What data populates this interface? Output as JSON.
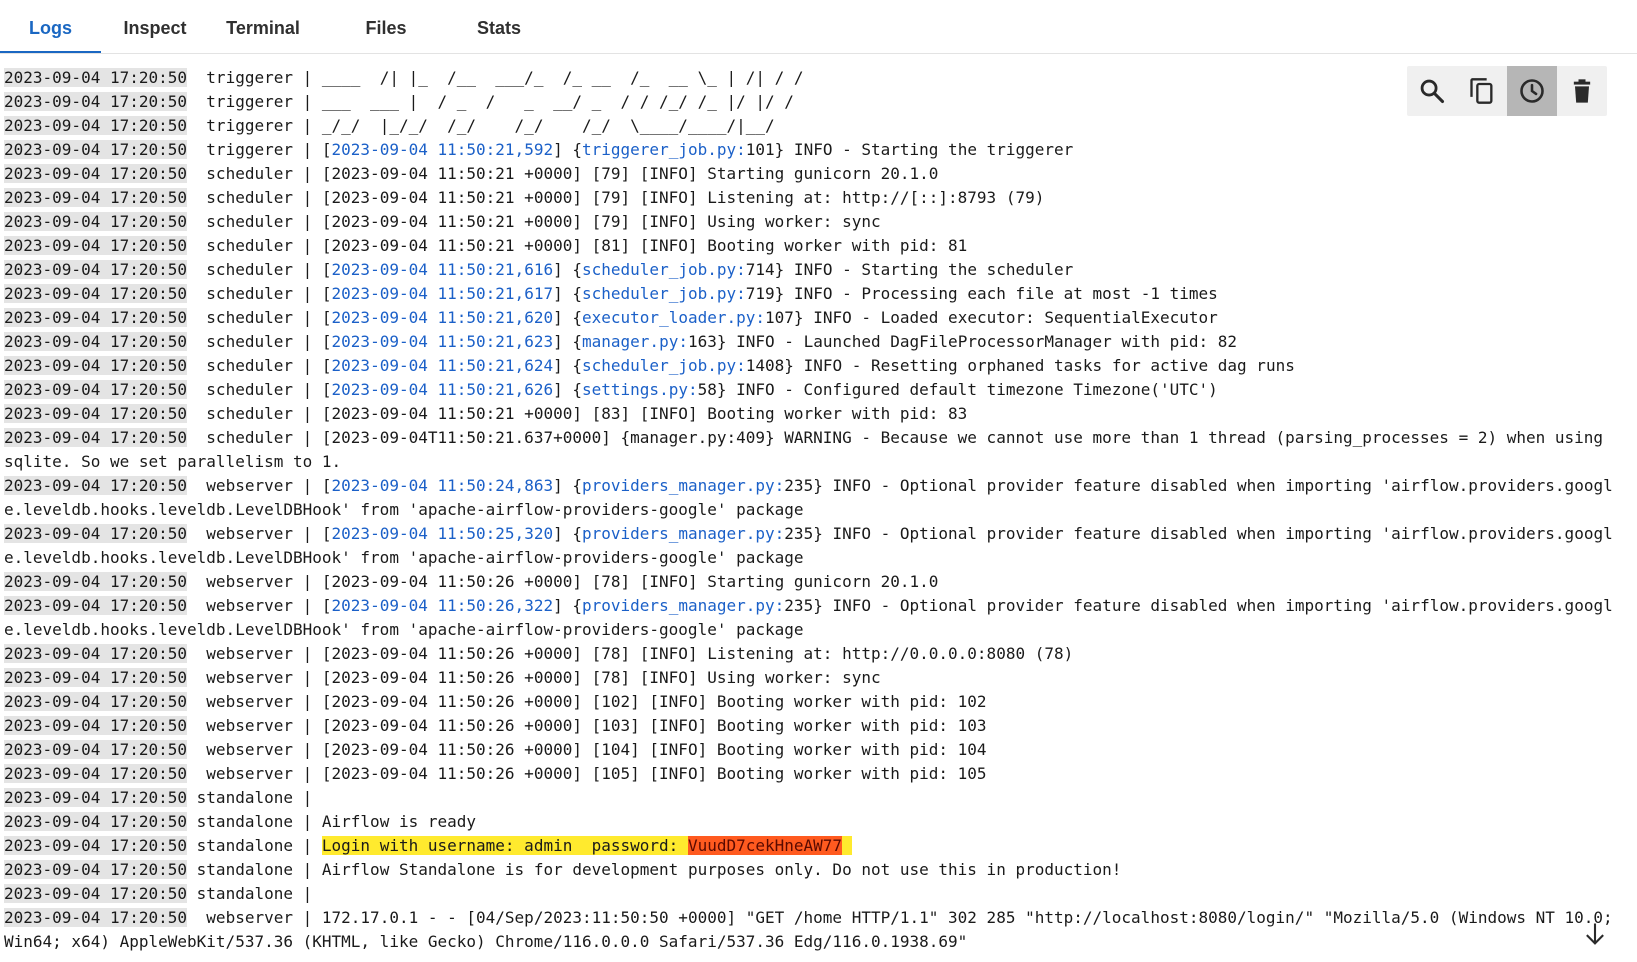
{
  "tabs": [
    {
      "label": "Logs"
    },
    {
      "label": "Inspect"
    },
    {
      "label": "Terminal"
    },
    {
      "label": "Files"
    },
    {
      "label": "Stats"
    }
  ],
  "toolbar": {
    "search": "search-icon",
    "copy": "copy-icon",
    "timestamps": "clock-icon",
    "clear": "trash-icon"
  },
  "scroll_icon": "arrow-down-icon",
  "colors": {
    "accent": "#1a67c2",
    "link": "#1b60c8",
    "highlight": "#ffea2e",
    "highlight_secret": "#ff5a1f"
  },
  "logs": [
    {
      "ts": "2023-09-04 17:20:50",
      "segs": [
        {
          "t": "  triggerer | ____  /| |_  /__  ___/_  /_ __  /_  __ \\_ | /| / /"
        }
      ]
    },
    {
      "ts": "2023-09-04 17:20:50",
      "segs": [
        {
          "t": "  triggerer | ___  ___ |  / _  /   _  __/ _  / / /_/ /_ |/ |/ /"
        }
      ]
    },
    {
      "ts": "2023-09-04 17:20:50",
      "segs": [
        {
          "t": "  triggerer | _/_/  |_/_/  /_/    /_/    /_/  \\____/____/|__/"
        }
      ]
    },
    {
      "ts": "2023-09-04 17:20:50",
      "segs": [
        {
          "t": "  triggerer | ["
        },
        {
          "t": "2023-09-04 11:50:21,592",
          "c": "lnk"
        },
        {
          "t": "] {"
        },
        {
          "t": "triggerer_job.py:",
          "c": "lnk"
        },
        {
          "t": "101} INFO - Starting the triggerer"
        }
      ]
    },
    {
      "ts": "2023-09-04 17:20:50",
      "segs": [
        {
          "t": "  scheduler | [2023-09-04 11:50:21 +0000] [79] [INFO] Starting gunicorn 20.1.0"
        }
      ]
    },
    {
      "ts": "2023-09-04 17:20:50",
      "segs": [
        {
          "t": "  scheduler | [2023-09-04 11:50:21 +0000] [79] [INFO] Listening at: http://[::]:8793 (79)"
        }
      ]
    },
    {
      "ts": "2023-09-04 17:20:50",
      "segs": [
        {
          "t": "  scheduler | [2023-09-04 11:50:21 +0000] [79] [INFO] Using worker: sync"
        }
      ]
    },
    {
      "ts": "2023-09-04 17:20:50",
      "segs": [
        {
          "t": "  scheduler | [2023-09-04 11:50:21 +0000] [81] [INFO] Booting worker with pid: 81"
        }
      ]
    },
    {
      "ts": "2023-09-04 17:20:50",
      "segs": [
        {
          "t": "  scheduler | ["
        },
        {
          "t": "2023-09-04 11:50:21,616",
          "c": "lnk"
        },
        {
          "t": "] {"
        },
        {
          "t": "scheduler_job.py:",
          "c": "lnk"
        },
        {
          "t": "714} INFO - Starting the scheduler"
        }
      ]
    },
    {
      "ts": "2023-09-04 17:20:50",
      "segs": [
        {
          "t": "  scheduler | ["
        },
        {
          "t": "2023-09-04 11:50:21,617",
          "c": "lnk"
        },
        {
          "t": "] {"
        },
        {
          "t": "scheduler_job.py:",
          "c": "lnk"
        },
        {
          "t": "719} INFO - Processing each file at most -1 times"
        }
      ]
    },
    {
      "ts": "2023-09-04 17:20:50",
      "segs": [
        {
          "t": "  scheduler | ["
        },
        {
          "t": "2023-09-04 11:50:21,620",
          "c": "lnk"
        },
        {
          "t": "] {"
        },
        {
          "t": "executor_loader.py:",
          "c": "lnk"
        },
        {
          "t": "107} INFO - Loaded executor: SequentialExecutor"
        }
      ]
    },
    {
      "ts": "2023-09-04 17:20:50",
      "segs": [
        {
          "t": "  scheduler | ["
        },
        {
          "t": "2023-09-04 11:50:21,623",
          "c": "lnk"
        },
        {
          "t": "] {"
        },
        {
          "t": "manager.py:",
          "c": "lnk"
        },
        {
          "t": "163} INFO - Launched DagFileProcessorManager with pid: 82"
        }
      ]
    },
    {
      "ts": "2023-09-04 17:20:50",
      "segs": [
        {
          "t": "  scheduler | ["
        },
        {
          "t": "2023-09-04 11:50:21,624",
          "c": "lnk"
        },
        {
          "t": "] {"
        },
        {
          "t": "scheduler_job.py:",
          "c": "lnk"
        },
        {
          "t": "1408} INFO - Resetting orphaned tasks for active dag runs"
        }
      ]
    },
    {
      "ts": "2023-09-04 17:20:50",
      "segs": [
        {
          "t": "  scheduler | ["
        },
        {
          "t": "2023-09-04 11:50:21,626",
          "c": "lnk"
        },
        {
          "t": "] {"
        },
        {
          "t": "settings.py:",
          "c": "lnk"
        },
        {
          "t": "58} INFO - Configured default timezone Timezone('UTC')"
        }
      ]
    },
    {
      "ts": "2023-09-04 17:20:50",
      "segs": [
        {
          "t": "  scheduler | [2023-09-04 11:50:21 +0000] [83] [INFO] Booting worker with pid: 83"
        }
      ]
    },
    {
      "ts": "2023-09-04 17:20:50",
      "segs": [
        {
          "t": "  scheduler | [2023-09-04T11:50:21.637+0000] {manager.py:409} WARNING - Because we cannot use more than 1 thread (parsing_processes = 2) when using sqlite. So we set parallelism to 1."
        }
      ]
    },
    {
      "ts": "2023-09-04 17:20:50",
      "segs": [
        {
          "t": "  webserver | ["
        },
        {
          "t": "2023-09-04 11:50:24,863",
          "c": "lnk"
        },
        {
          "t": "] {"
        },
        {
          "t": "providers_manager.py:",
          "c": "lnk"
        },
        {
          "t": "235} INFO - Optional provider feature disabled when importing 'airflow.providers.google.leveldb.hooks.leveldb.LevelDBHook' from 'apache-airflow-providers-google' package"
        }
      ]
    },
    {
      "ts": "2023-09-04 17:20:50",
      "segs": [
        {
          "t": "  webserver | ["
        },
        {
          "t": "2023-09-04 11:50:25,320",
          "c": "lnk"
        },
        {
          "t": "] {"
        },
        {
          "t": "providers_manager.py:",
          "c": "lnk"
        },
        {
          "t": "235} INFO - Optional provider feature disabled when importing 'airflow.providers.google.leveldb.hooks.leveldb.LevelDBHook' from 'apache-airflow-providers-google' package"
        }
      ]
    },
    {
      "ts": "2023-09-04 17:20:50",
      "segs": [
        {
          "t": "  webserver | [2023-09-04 11:50:26 +0000] [78] [INFO] Starting gunicorn 20.1.0"
        }
      ]
    },
    {
      "ts": "2023-09-04 17:20:50",
      "segs": [
        {
          "t": "  webserver | ["
        },
        {
          "t": "2023-09-04 11:50:26,322",
          "c": "lnk"
        },
        {
          "t": "] {"
        },
        {
          "t": "providers_manager.py:",
          "c": "lnk"
        },
        {
          "t": "235} INFO - Optional provider feature disabled when importing 'airflow.providers.google.leveldb.hooks.leveldb.LevelDBHook' from 'apache-airflow-providers-google' package"
        }
      ]
    },
    {
      "ts": "2023-09-04 17:20:50",
      "segs": [
        {
          "t": "  webserver | [2023-09-04 11:50:26 +0000] [78] [INFO] Listening at: http://0.0.0.0:8080 (78)"
        }
      ]
    },
    {
      "ts": "2023-09-04 17:20:50",
      "segs": [
        {
          "t": "  webserver | [2023-09-04 11:50:26 +0000] [78] [INFO] Using worker: sync"
        }
      ]
    },
    {
      "ts": "2023-09-04 17:20:50",
      "segs": [
        {
          "t": "  webserver | [2023-09-04 11:50:26 +0000] [102] [INFO] Booting worker with pid: 102"
        }
      ]
    },
    {
      "ts": "2023-09-04 17:20:50",
      "segs": [
        {
          "t": "  webserver | [2023-09-04 11:50:26 +0000] [103] [INFO] Booting worker with pid: 103"
        }
      ]
    },
    {
      "ts": "2023-09-04 17:20:50",
      "segs": [
        {
          "t": "  webserver | [2023-09-04 11:50:26 +0000] [104] [INFO] Booting worker with pid: 104"
        }
      ]
    },
    {
      "ts": "2023-09-04 17:20:50",
      "segs": [
        {
          "t": "  webserver | [2023-09-04 11:50:26 +0000] [105] [INFO] Booting worker with pid: 105"
        }
      ]
    },
    {
      "ts": "2023-09-04 17:20:50",
      "segs": [
        {
          "t": " standalone |"
        }
      ]
    },
    {
      "ts": "2023-09-04 17:20:50",
      "segs": [
        {
          "t": " standalone | Airflow is ready"
        }
      ]
    },
    {
      "ts": "2023-09-04 17:20:50",
      "segs": [
        {
          "t": " standalone | "
        },
        {
          "t": "Login with username: admin  password: ",
          "c": "hl"
        },
        {
          "t": "VuudD7cekHneAW77",
          "c": "hlr"
        },
        {
          "t": " ",
          "c": "hl"
        }
      ]
    },
    {
      "ts": "2023-09-04 17:20:50",
      "segs": [
        {
          "t": " standalone | Airflow Standalone is for development purposes only. Do not use this in production!"
        }
      ]
    },
    {
      "ts": "2023-09-04 17:20:50",
      "segs": [
        {
          "t": " standalone |"
        }
      ]
    },
    {
      "ts": "2023-09-04 17:20:50",
      "segs": [
        {
          "t": "  webserver | 172.17.0.1 - - [04/Sep/2023:11:50:50 +0000] \"GET /home HTTP/1.1\" 302 285 \"http://localhost:8080/login/\" \"Mozilla/5.0 (Windows NT 10.0; Win64; x64) AppleWebKit/537.36 (KHTML, like Gecko) Chrome/116.0.0.0 Safari/537.36 Edg/116.0.1938.69\""
        }
      ]
    }
  ]
}
